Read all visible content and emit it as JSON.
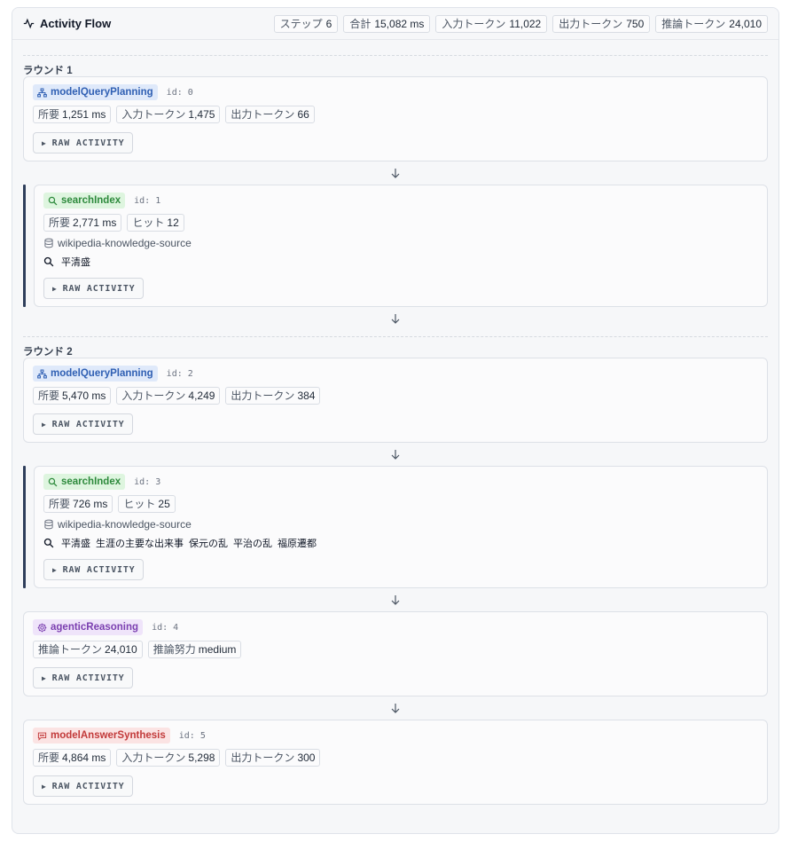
{
  "header": {
    "title": "Activity Flow",
    "stats": [
      {
        "k": "ステップ",
        "v": "6"
      },
      {
        "k": "合計",
        "v": "15,082 ms"
      },
      {
        "k": "入力トークン",
        "v": "11,022"
      },
      {
        "k": "出力トークン",
        "v": "750"
      },
      {
        "k": "推論トークン",
        "v": "24,010"
      }
    ]
  },
  "rounds": [
    {
      "label": "ラウンド 1"
    },
    {
      "label": "ラウンド 2"
    }
  ],
  "raw_label": "RAW ACTIVITY",
  "steps": [
    {
      "type": "modelQueryPlanning",
      "id": "id: 0",
      "metrics": [
        {
          "k": "所要",
          "v": "1,251 ms"
        },
        {
          "k": "入力トークン",
          "v": "1,475"
        },
        {
          "k": "出力トークン",
          "v": "66"
        }
      ]
    },
    {
      "type": "searchIndex",
      "id": "id: 1",
      "metrics": [
        {
          "k": "所要",
          "v": "2,771 ms"
        },
        {
          "k": "ヒット",
          "v": "12"
        }
      ],
      "source": "wikipedia-knowledge-source",
      "query": [
        "平清盛"
      ]
    },
    {
      "type": "modelQueryPlanning",
      "id": "id: 2",
      "metrics": [
        {
          "k": "所要",
          "v": "5,470 ms"
        },
        {
          "k": "入力トークン",
          "v": "4,249"
        },
        {
          "k": "出力トークン",
          "v": "384"
        }
      ]
    },
    {
      "type": "searchIndex",
      "id": "id: 3",
      "metrics": [
        {
          "k": "所要",
          "v": "726 ms"
        },
        {
          "k": "ヒット",
          "v": "25"
        }
      ],
      "source": "wikipedia-knowledge-source",
      "query": [
        "平清盛",
        "生涯の主要な出来事",
        "保元の乱",
        "平治の乱",
        "福原遷都"
      ]
    },
    {
      "type": "agenticReasoning",
      "id": "id: 4",
      "metrics": [
        {
          "k": "推論トークン",
          "v": "24,010"
        },
        {
          "k": "推論努力",
          "v": "medium"
        }
      ]
    },
    {
      "type": "modelAnswerSynthesis",
      "id": "id: 5",
      "metrics": [
        {
          "k": "所要",
          "v": "4,864 ms"
        },
        {
          "k": "入力トークン",
          "v": "5,298"
        },
        {
          "k": "出力トークン",
          "v": "300"
        }
      ]
    }
  ],
  "colors": {
    "plan": "#2f5fb3",
    "search": "#2d8a3c",
    "reason": "#7b3fb0",
    "synth": "#c23a3a",
    "rail": "#2f3e5b"
  }
}
